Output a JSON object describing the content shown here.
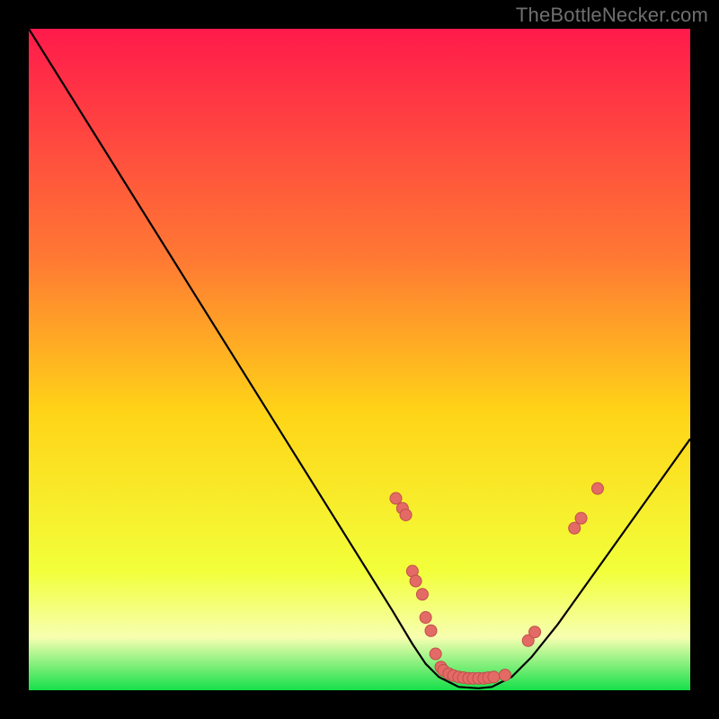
{
  "attribution": "TheBottleNecker.com",
  "colors": {
    "curve": "#000000",
    "point_fill": "#e46a66",
    "point_stroke": "#bf4f4b",
    "grad_top": "#ff1a4b",
    "grad_mid_upper": "#ff7a33",
    "grad_mid": "#ffd417",
    "grad_lower": "#f2ff3a",
    "grad_band_light": "#f7ffb0",
    "grad_bottom": "#16e04a"
  },
  "chart_data": {
    "type": "line",
    "title": "",
    "xlabel": "",
    "ylabel": "",
    "xlim": [
      0,
      100
    ],
    "ylim": [
      0,
      100
    ],
    "series": [
      {
        "name": "bottleneck-curve",
        "x": [
          0,
          5,
          10,
          15,
          20,
          25,
          30,
          35,
          40,
          45,
          50,
          55,
          58,
          60,
          62,
          65,
          68,
          70,
          73,
          76,
          80,
          85,
          90,
          95,
          100
        ],
        "y": [
          100,
          92,
          84,
          76,
          68,
          60,
          52,
          44,
          36,
          28,
          20,
          12,
          7,
          4,
          2,
          0.5,
          0.3,
          0.5,
          2,
          5,
          10,
          17,
          24,
          31,
          38
        ]
      }
    ],
    "points": [
      {
        "x": 55.5,
        "y": 29.0
      },
      {
        "x": 56.5,
        "y": 27.5
      },
      {
        "x": 57.0,
        "y": 26.5
      },
      {
        "x": 58.0,
        "y": 18.0
      },
      {
        "x": 58.5,
        "y": 16.5
      },
      {
        "x": 59.5,
        "y": 14.5
      },
      {
        "x": 60.0,
        "y": 11.0
      },
      {
        "x": 60.8,
        "y": 9.0
      },
      {
        "x": 61.5,
        "y": 5.5
      },
      {
        "x": 62.3,
        "y": 3.5
      },
      {
        "x": 62.7,
        "y": 3.0
      },
      {
        "x": 63.5,
        "y": 2.5
      },
      {
        "x": 64.2,
        "y": 2.2
      },
      {
        "x": 65.0,
        "y": 2.0
      },
      {
        "x": 65.7,
        "y": 1.9
      },
      {
        "x": 66.5,
        "y": 1.8
      },
      {
        "x": 67.2,
        "y": 1.8
      },
      {
        "x": 68.0,
        "y": 1.8
      },
      {
        "x": 68.8,
        "y": 1.8
      },
      {
        "x": 69.5,
        "y": 1.9
      },
      {
        "x": 70.3,
        "y": 2.0
      },
      {
        "x": 72.0,
        "y": 2.3
      },
      {
        "x": 75.5,
        "y": 7.5
      },
      {
        "x": 76.5,
        "y": 8.8
      },
      {
        "x": 82.5,
        "y": 24.5
      },
      {
        "x": 83.5,
        "y": 26.0
      },
      {
        "x": 86.0,
        "y": 30.5
      }
    ]
  }
}
